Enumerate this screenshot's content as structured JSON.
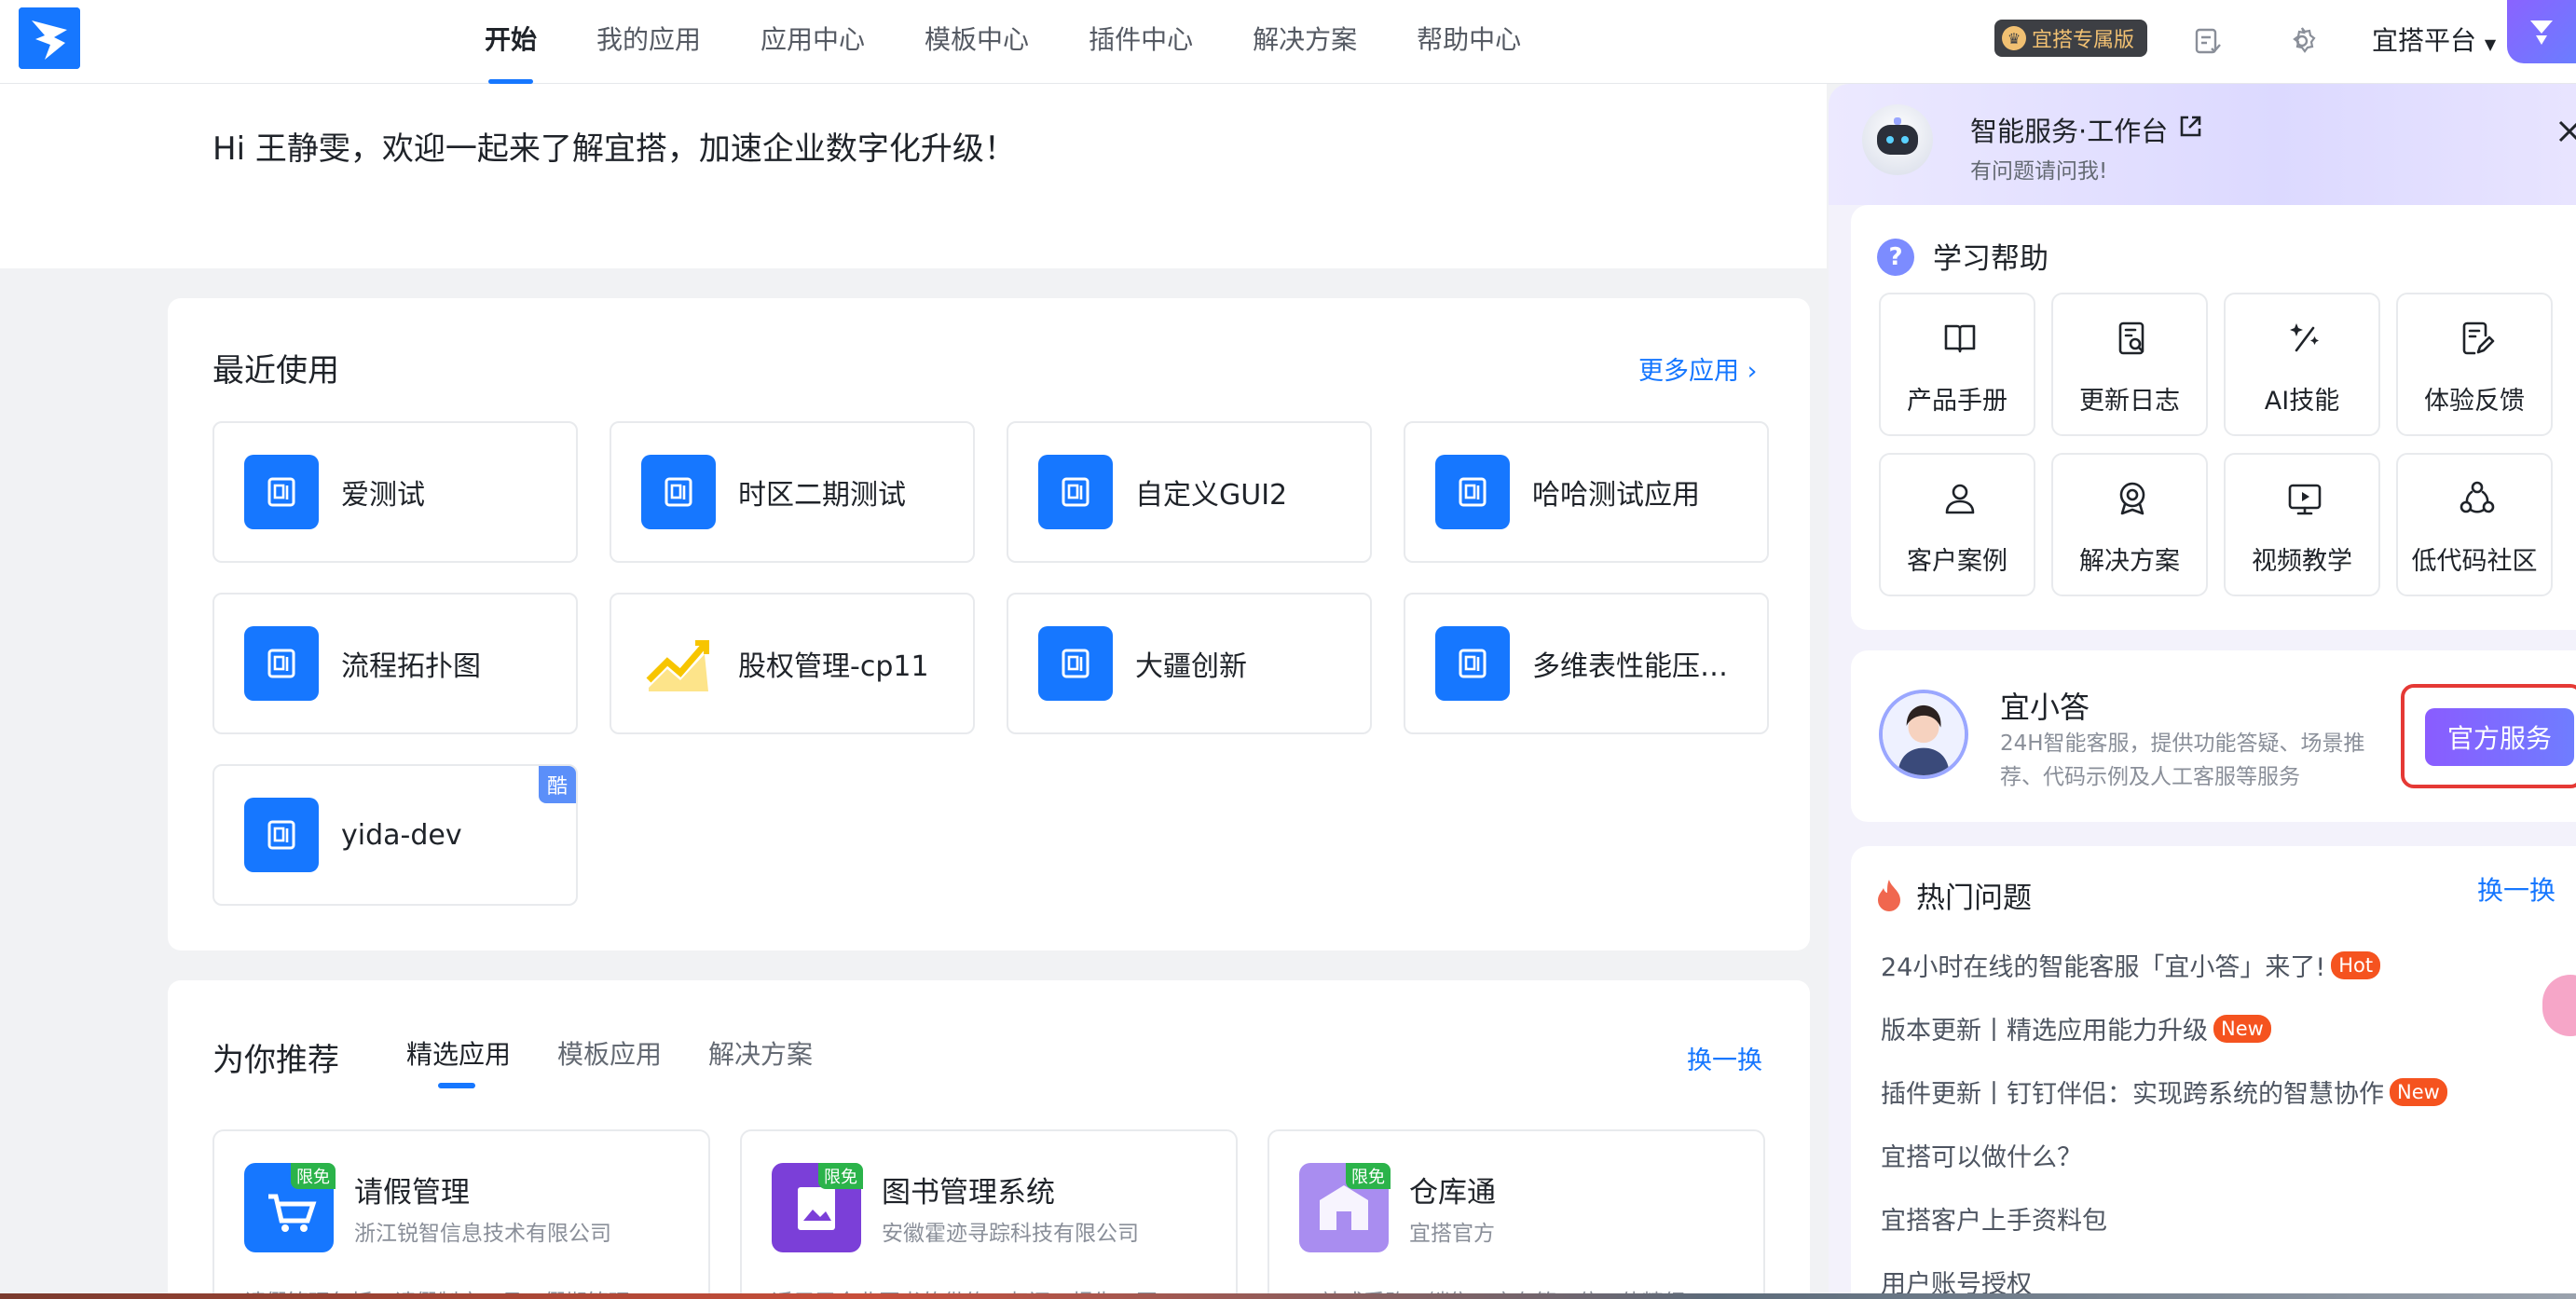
{
  "nav": {
    "items": [
      "开始",
      "我的应用",
      "应用中心",
      "模板中心",
      "插件中心",
      "解决方案",
      "帮助中心"
    ],
    "edition_badge": "宜搭专属版",
    "platform_label": "宜搭平台"
  },
  "welcome": "Hi 王静雯，欢迎一起来了解宜搭，加速企业数字化升级！",
  "recent": {
    "title": "最近使用",
    "more": "更多应用",
    "apps": [
      {
        "name": "爱测试",
        "icon": "form-icon"
      },
      {
        "name": "时区二期测试",
        "icon": "form-icon"
      },
      {
        "name": "自定义GUI2",
        "icon": "form-icon"
      },
      {
        "name": "哈哈测试应用",
        "icon": "form-icon"
      },
      {
        "name": "流程拓扑图",
        "icon": "form-icon"
      },
      {
        "name": "股权管理-cp11",
        "icon": "chart-icon"
      },
      {
        "name": "大疆创新",
        "icon": "form-icon"
      },
      {
        "name": "多维表性能压…",
        "icon": "form-icon"
      },
      {
        "name": "yida-dev",
        "icon": "form-icon",
        "tag": "酷"
      }
    ]
  },
  "recommend": {
    "title": "为你推荐",
    "tabs": [
      "精选应用",
      "模板应用",
      "解决方案"
    ],
    "swap": "换一换",
    "items": [
      {
        "name": "请假管理",
        "org": "浙江锐智信息技术有限公司",
        "desc": "请假管理包括：请假制度、员工假期管理",
        "tag": "限免"
      },
      {
        "name": "图书管理系统",
        "org": "安徽霍迹寻踪科技有限公司",
        "desc": "适用于企业图书的借约、归还、报失、图",
        "tag": "限免"
      },
      {
        "name": "仓库通",
        "org": "宜搭官方",
        "desc": "一站式采购、销售、库存第三位一体精细",
        "tag": "限免"
      }
    ]
  },
  "panel": {
    "title": "智能服务·工作台",
    "subtitle": "有问题请问我!",
    "learn_title": "学习帮助",
    "help_items": [
      {
        "label": "产品手册",
        "icon": "book-icon"
      },
      {
        "label": "更新日志",
        "icon": "log-icon"
      },
      {
        "label": "AI技能",
        "icon": "ai-icon"
      },
      {
        "label": "体验反馈",
        "icon": "feedback-icon"
      },
      {
        "label": "客户案例",
        "icon": "user-icon"
      },
      {
        "label": "解决方案",
        "icon": "badge-icon"
      },
      {
        "label": "视频教学",
        "icon": "video-icon"
      },
      {
        "label": "低代码社区",
        "icon": "community-icon"
      }
    ],
    "assistant": {
      "name": "宜小答",
      "desc": "24H智能客服，提供功能答疑、场景推荐、代码示例及人工客服等服务",
      "button": "官方服务"
    },
    "hot": {
      "title": "热门问题",
      "swap": "换一换",
      "items": [
        {
          "text": "24小时在线的智能客服「宜小答」来了!",
          "tag": "Hot"
        },
        {
          "text": "版本更新丨精选应用能力升级",
          "tag": "New"
        },
        {
          "text": "插件更新丨钉钉伴侣：实现跨系统的智慧协作",
          "tag": "New"
        },
        {
          "text": "宜搭可以做什么？",
          "tag": ""
        },
        {
          "text": "宜搭客户上手资料包",
          "tag": ""
        },
        {
          "text": "用户账号授权",
          "tag": ""
        }
      ]
    }
  },
  "colors": {
    "accent": "#1677ff",
    "panel_button": "#7b6cff",
    "hot_tag": "#f5531f",
    "free_tag": "#2bb34a"
  }
}
